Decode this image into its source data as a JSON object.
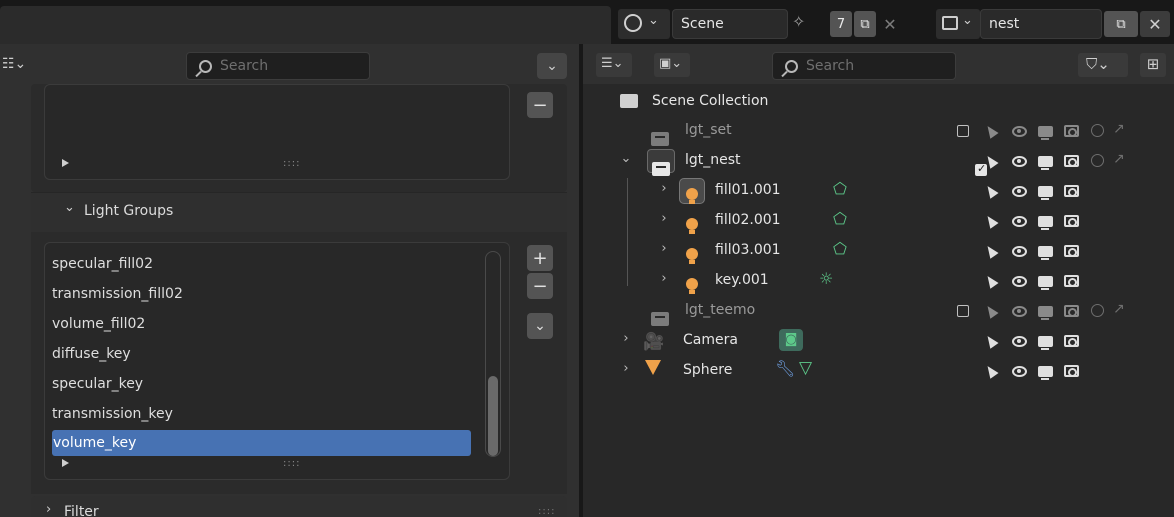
{
  "topbar": {
    "scene_label": "Scene",
    "user_count": "7",
    "view_layer": "nest"
  },
  "left_panel": {
    "search_placeholder": "Search",
    "section_light_groups": "Light Groups",
    "section_filter": "Filter",
    "grip": "::::",
    "add_label": "+",
    "remove_label": "−",
    "light_groups": [
      "specular_fill02",
      "transmission_fill02",
      "volume_fill02",
      "diffuse_key",
      "specular_key",
      "transmission_key",
      "volume_key"
    ],
    "selected_index": 6
  },
  "outliner": {
    "search_placeholder": "Search",
    "root": "Scene Collection",
    "items": [
      {
        "name": "lgt_set",
        "type": "collection",
        "excluded": true
      },
      {
        "name": "lgt_nest",
        "type": "collection",
        "expanded": true
      },
      {
        "name": "fill01.001",
        "type": "light",
        "active": true
      },
      {
        "name": "fill02.001",
        "type": "light"
      },
      {
        "name": "fill03.001",
        "type": "light"
      },
      {
        "name": "key.001",
        "type": "light"
      },
      {
        "name": "lgt_teemo",
        "type": "collection",
        "excluded": true
      },
      {
        "name": "Camera",
        "type": "camera"
      },
      {
        "name": "Sphere",
        "type": "mesh"
      }
    ]
  },
  "colors": {
    "selection": "#4772b3",
    "light_icon": "#f0a24a",
    "light_data": "#5dc98a",
    "modifier": "#6e9ee0"
  },
  "icons": [
    "scene-icon",
    "pin-icon",
    "duplicate-icon",
    "close-icon",
    "view-layer-icon",
    "filter-icon",
    "new-collection-icon",
    "eye-icon",
    "monitor-icon",
    "camera-icon",
    "select-arrow-icon"
  ]
}
